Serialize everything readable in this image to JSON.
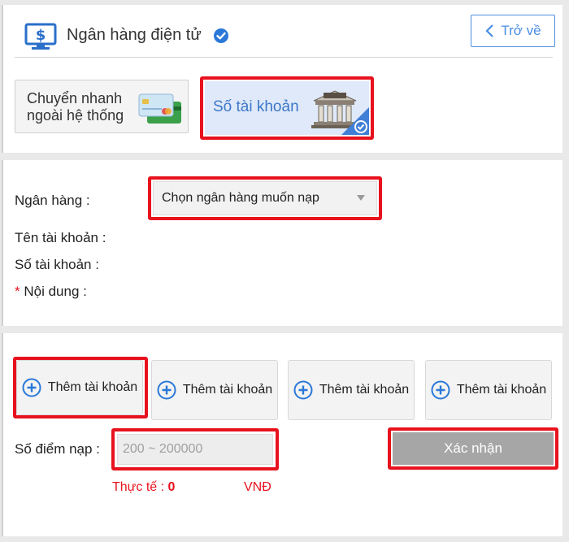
{
  "header": {
    "title": "Ngân hàng điện tử",
    "back_label": "Trở về"
  },
  "methods": [
    {
      "label_line1": "Chuyển nhanh",
      "label_line2": "ngoài hệ thống",
      "icon": "cards-icon",
      "selected": false
    },
    {
      "label": "Số tài khoản",
      "icon": "bank-icon",
      "selected": true
    }
  ],
  "form": {
    "bank_label": "Ngân hàng :",
    "bank_select_value": "Chọn ngân hàng muốn nạp",
    "account_name_label": "Tên tài khoản :",
    "account_number_label": "Số tài khoản :",
    "content_required_mark": "*",
    "content_label": "Nội dung :"
  },
  "add_accounts": [
    {
      "label": "Thêm tài khoản"
    },
    {
      "label": "Thêm tài khoản"
    },
    {
      "label": "Thêm tài khoản"
    },
    {
      "label": "Thêm tài khoản"
    }
  ],
  "deposit": {
    "points_label": "Số điểm nạp :",
    "points_placeholder": "200 ~ 200000",
    "confirm_label": "Xác nhận",
    "actual_label": "Thực tế :",
    "actual_value": "0",
    "currency": "VNĐ"
  },
  "colors": {
    "accent": "#4a8ee3",
    "highlight": "#e8121e",
    "selected_bg": "#dfe9f9",
    "confirm_bg": "#a6a6a6"
  }
}
